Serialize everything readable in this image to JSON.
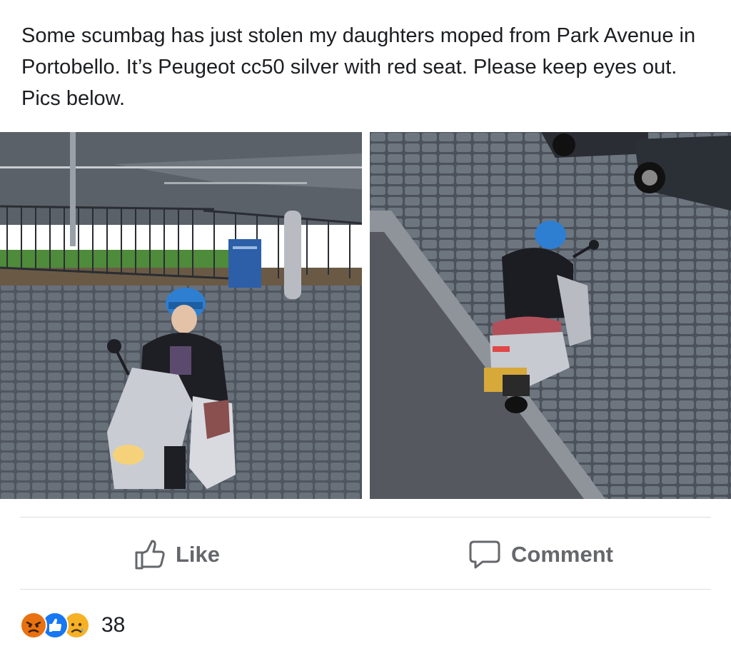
{
  "post": {
    "text": "Some scumbag has just stolen my daughters moped from Park Avenue in Portobello. It’s Peugeot  cc50 silver with red seat. Please keep eyes out. Pics below."
  },
  "photos": [
    {
      "description_icon": "photo-rider-on-moped"
    },
    {
      "description_icon": "photo-rider-from-behind"
    }
  ],
  "actions": {
    "like_label": "Like",
    "comment_label": "Comment"
  },
  "reactions": {
    "icons": [
      "angry-reaction-icon",
      "like-reaction-icon",
      "sad-reaction-icon"
    ],
    "count": "38"
  },
  "colors": {
    "text": "#1c1e21",
    "action_text": "#65676b",
    "divider": "#dadde1",
    "like_blue": "#1877f2",
    "angry": "#e9710f",
    "sad": "#f7b125"
  }
}
